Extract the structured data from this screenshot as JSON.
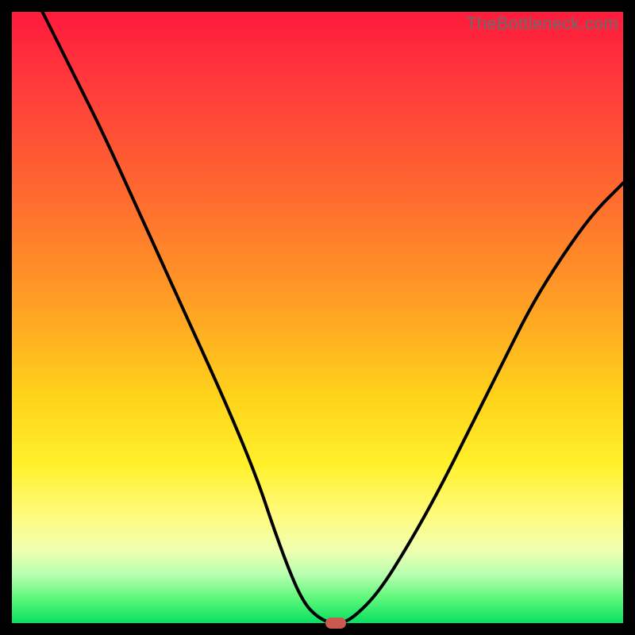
{
  "watermark": "TheBottleneck.com",
  "colors": {
    "curve": "#000000",
    "marker": "#c95a52"
  },
  "chart_data": {
    "type": "line",
    "title": "",
    "xlabel": "",
    "ylabel": "",
    "xlim": [
      0,
      100
    ],
    "ylim": [
      0,
      100
    ],
    "grid": false,
    "legend": false,
    "annotations": [],
    "series": [
      {
        "name": "bottleneck-curve",
        "x_note": "x interpreted as 0..100 left->right across the gradient area",
        "y_note": "y interpreted as 0..100 bottom->top; 0 is the green baseline, 100 is the top edge",
        "x": [
          5,
          10,
          15,
          20,
          25,
          30,
          35,
          40,
          43,
          46,
          48,
          50,
          52,
          54,
          56,
          60,
          65,
          70,
          75,
          80,
          85,
          90,
          95,
          100
        ],
        "y": [
          100,
          90,
          80,
          69,
          58,
          47,
          36,
          24,
          15,
          7,
          3,
          1,
          0,
          0,
          1,
          5,
          13,
          22,
          32,
          42,
          52,
          60,
          67,
          72
        ]
      }
    ],
    "marker": {
      "x": 53,
      "y": 0,
      "label": ""
    }
  }
}
